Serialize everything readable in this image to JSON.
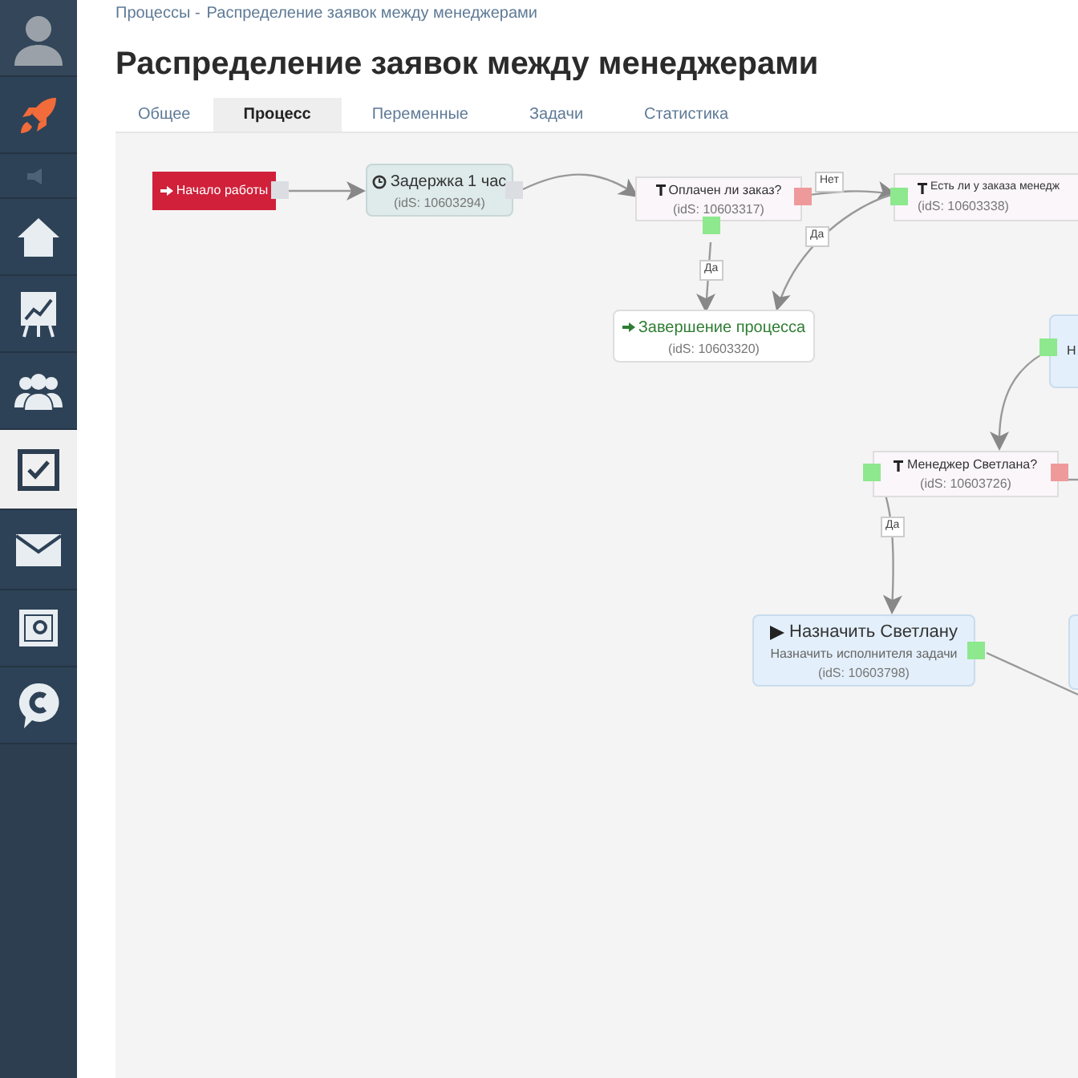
{
  "sidebar": {
    "items": [
      {
        "selected": false
      },
      {
        "selected": false
      },
      {
        "selected": false
      },
      {
        "selected": false
      },
      {
        "selected": false
      },
      {
        "selected": false
      },
      {
        "selected": true
      },
      {
        "selected": false
      },
      {
        "selected": false
      },
      {
        "selected": false
      }
    ]
  },
  "breadcrumb": {
    "parent": "Процессы -",
    "current": "Распределение заявок между менеджерами"
  },
  "title": "Распределение заявок между менеджерами",
  "tabs": [
    {
      "label": "Общее",
      "selected": false
    },
    {
      "label": "Процесс",
      "selected": true
    },
    {
      "label": "Переменные",
      "selected": false
    },
    {
      "label": "Задачи",
      "selected": false
    },
    {
      "label": "Статистика",
      "selected": false
    }
  ],
  "diagram": {
    "nodes": [
      {
        "kind": "start",
        "title": "Начало работы"
      },
      {
        "kind": "delay",
        "title": "Задержка 1 час",
        "ids": "(idS: 10603294)"
      },
      {
        "kind": "condition",
        "title": "Оплачен ли заказ?",
        "ids": "(idS: 10603317)"
      },
      {
        "kind": "condition",
        "title": "Есть ли у заказа менедж",
        "ids": "(idS: 10603338)"
      },
      {
        "kind": "end",
        "title": "Завершение процесса",
        "ids": "(idS: 10603320)"
      },
      {
        "kind": "action",
        "title": "Н"
      },
      {
        "kind": "condition",
        "title": "Менеджер Светлана?",
        "ids": "(idS: 10603726)"
      },
      {
        "kind": "action",
        "title": "Назначить Светлану",
        "subtitle": "Назначить исполнителя задачи",
        "ids": "(idS: 10603798)"
      },
      {
        "kind": "action"
      }
    ],
    "edge_labels": [
      "Нет",
      "Да",
      "Да",
      "Да"
    ]
  }
}
